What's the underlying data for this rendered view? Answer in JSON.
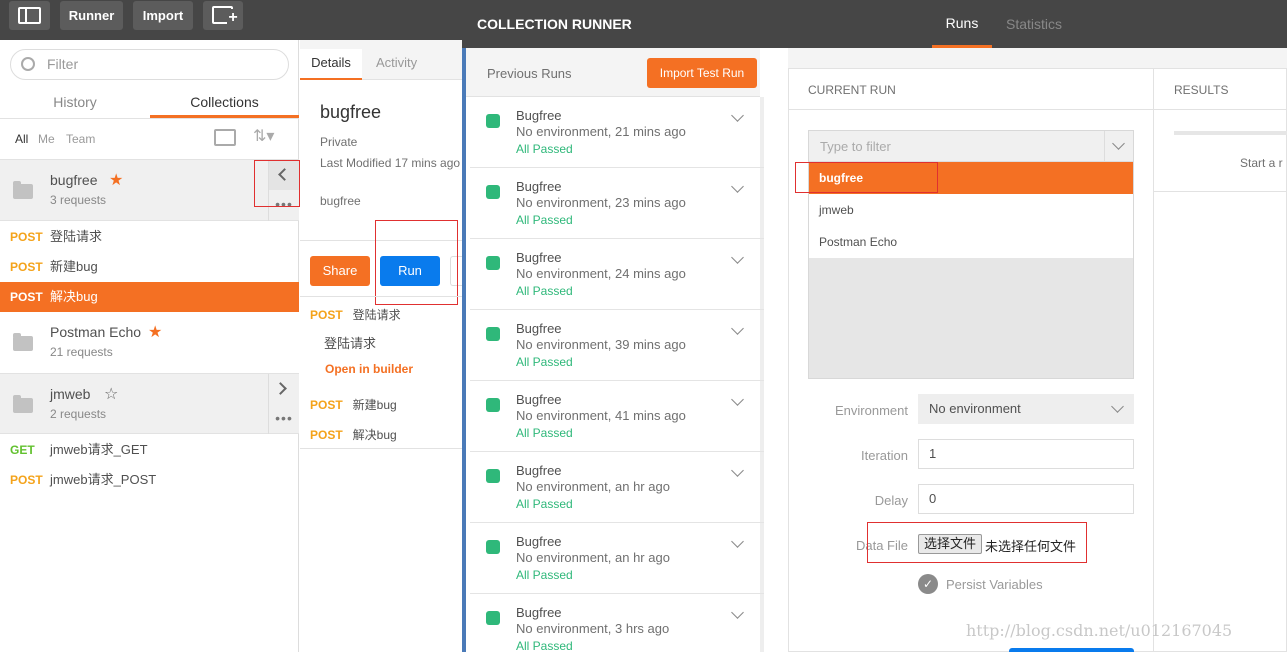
{
  "toolbar": {
    "runner": "Runner",
    "import": "Import"
  },
  "sidebar": {
    "filter_placeholder": "Filter",
    "tabs": [
      "History",
      "Collections"
    ],
    "scope": [
      "All",
      "Me",
      "Team"
    ],
    "collections": [
      {
        "name": "bugfree",
        "count": "3 requests"
      },
      {
        "name": "Postman Echo",
        "count": "21 requests"
      },
      {
        "name": "jmweb",
        "count": "2 requests"
      }
    ],
    "bugfree_requests": [
      {
        "method": "POST",
        "name": "登陆请求"
      },
      {
        "method": "POST",
        "name": "新建bug"
      },
      {
        "method": "POST",
        "name": "解决bug"
      }
    ],
    "jmweb_requests": [
      {
        "method": "GET",
        "name": "jmweb请求_GET"
      },
      {
        "method": "POST",
        "name": "jmweb请求_POST"
      }
    ]
  },
  "details": {
    "tabs": [
      "Details",
      "Activity"
    ],
    "title": "bugfree",
    "privacy": "Private",
    "modified": "Last Modified 17 mins ago",
    "description": "bugfree",
    "share": "Share",
    "run": "Run",
    "requests": [
      {
        "method": "POST",
        "name": "登陆请求",
        "sub": "登陆请求",
        "open": "Open in builder"
      },
      {
        "method": "POST",
        "name": "新建bug"
      },
      {
        "method": "POST",
        "name": "解决bug"
      }
    ]
  },
  "runner": {
    "title": "COLLECTION RUNNER",
    "tabs": [
      "Runs",
      "Statistics"
    ],
    "previous_runs": "Previous Runs",
    "import_test_run": "Import Test Run",
    "runs": [
      {
        "name": "Bugfree",
        "env": "No environment, 21 mins ago",
        "status": "All Passed"
      },
      {
        "name": "Bugfree",
        "env": "No environment, 23 mins ago",
        "status": "All Passed"
      },
      {
        "name": "Bugfree",
        "env": "No environment, 24 mins ago",
        "status": "All Passed"
      },
      {
        "name": "Bugfree",
        "env": "No environment, 39 mins ago",
        "status": "All Passed"
      },
      {
        "name": "Bugfree",
        "env": "No environment, 41 mins ago",
        "status": "All Passed"
      },
      {
        "name": "Bugfree",
        "env": "No environment, an hr ago",
        "status": "All Passed"
      },
      {
        "name": "Bugfree",
        "env": "No environment, an hr ago",
        "status": "All Passed"
      },
      {
        "name": "Bugfree",
        "env": "No environment, 3 hrs ago",
        "status": "All Passed"
      }
    ],
    "current_run": "CURRENT RUN",
    "results": "RESULTS",
    "results_hint": "Start a r",
    "collection_filter_placeholder": "Type to filter",
    "collections": [
      "bugfree",
      "jmweb",
      "Postman Echo"
    ],
    "environment_label": "Environment",
    "environment_value": "No environment",
    "iteration_label": "Iteration",
    "iteration_value": "1",
    "delay_label": "Delay",
    "delay_value": "0",
    "datafile_label": "Data File",
    "choose_file": "选择文件",
    "no_file": "未选择任何文件",
    "persist": "Persist Variables"
  },
  "watermark": "http://blog.csdn.net/u012167045",
  "colors": {
    "accent": "#f47023",
    "blue": "#097bed",
    "pass": "#2fb87a",
    "dark": "#464646"
  }
}
